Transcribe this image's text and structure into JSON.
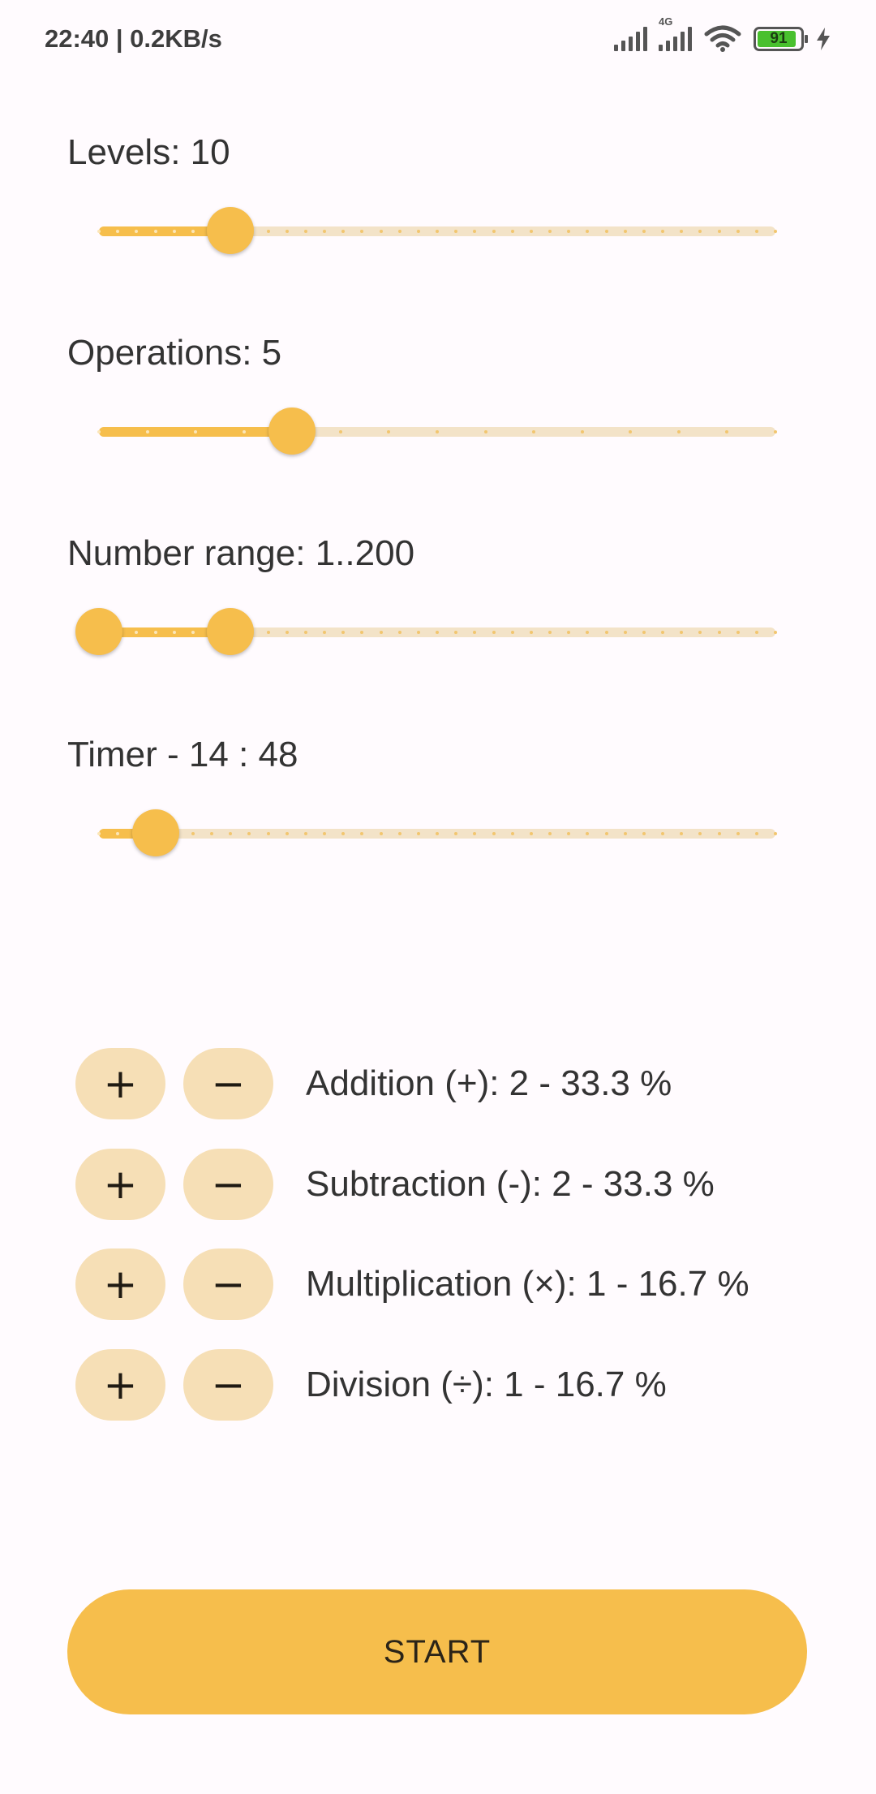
{
  "status_bar": {
    "time_speed": "22:40 | 0.2KB/s",
    "network_tag": "4G",
    "battery": "91",
    "battery_level": 0.91
  },
  "sliders": [
    {
      "label": "Levels: 10",
      "min": 1,
      "max": 37,
      "values": [
        8
      ],
      "ticks": 37
    },
    {
      "label": "Operations: 5",
      "min": 1,
      "max": 15,
      "values": [
        5
      ],
      "ticks": 15
    },
    {
      "label": "Number range: 1..200",
      "min": 1,
      "max": 37,
      "values": [
        1,
        8
      ],
      "ticks": 37
    },
    {
      "label": "Timer - 14 : 48",
      "min": 1,
      "max": 37,
      "values": [
        4
      ],
      "ticks": 37
    }
  ],
  "operations": [
    {
      "plus": "+",
      "minus": "−",
      "label": "Addition (+): 2 - 33.3 %"
    },
    {
      "plus": "+",
      "minus": "−",
      "label": "Subtraction (-): 2 - 33.3 %"
    },
    {
      "plus": "+",
      "minus": "−",
      "label": "Multiplication (×): 1 - 16.7 %"
    },
    {
      "plus": "+",
      "minus": "−",
      "label": "Division (÷): 1 - 16.7 %"
    }
  ],
  "start_label": "START",
  "colors": {
    "accent": "#F6BE4C",
    "track_inactive": "#F3E3C8",
    "button_tonal": "#F6DFB6",
    "background": "#FFFBFE"
  }
}
